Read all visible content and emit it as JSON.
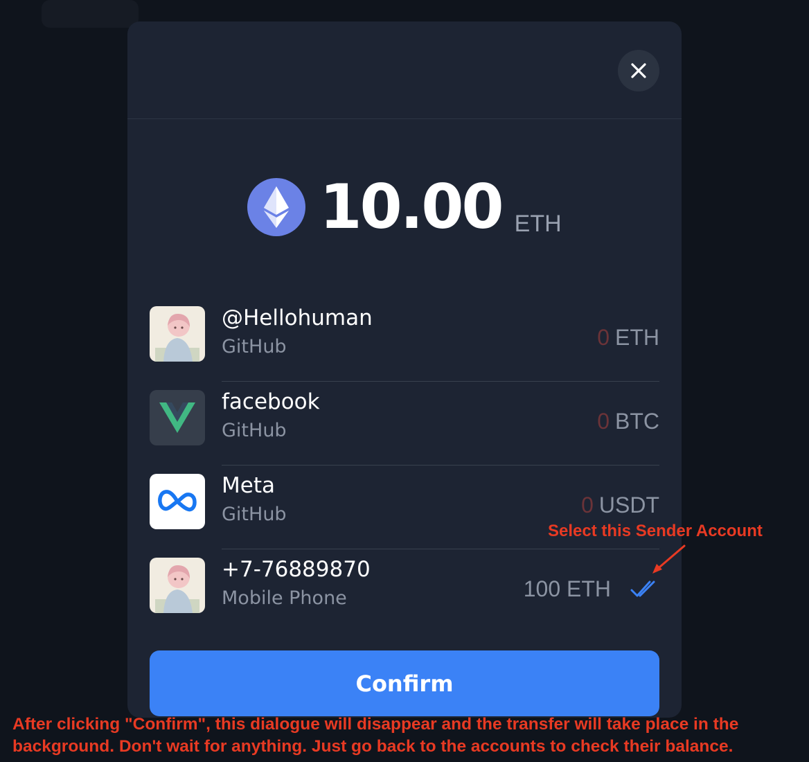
{
  "modal": {
    "close_label": "×",
    "amount": {
      "value": "10.00",
      "unit": "ETH",
      "icon": "ethereum-icon"
    },
    "accounts": [
      {
        "name": "@Hellohuman",
        "source": "GitHub",
        "balance_zero": "0",
        "balance_unit": "ETH",
        "avatar": "anime-avatar"
      },
      {
        "name": "facebook",
        "source": "GitHub",
        "balance_zero": "0",
        "balance_unit": "BTC",
        "avatar": "vue-logo"
      },
      {
        "name": "Meta",
        "source": "GitHub",
        "balance_zero": "0",
        "balance_unit": "USDT",
        "avatar": "meta-logo"
      },
      {
        "name": "+7-76889870",
        "source": "Mobile Phone",
        "balance": "100 ETH",
        "avatar": "anime-avatar",
        "selected": true
      }
    ],
    "confirm_label": "Confirm"
  },
  "annotations": {
    "select_sender": "Select this Sender Account",
    "bottom_note": "After clicking \"Confirm\", this dialogue will disappear and the transfer will take place in the background. Don't wait for anything. Just go back to the accounts to check their balance."
  },
  "colors": {
    "background": "#0f141c",
    "modal": "#1d2433",
    "accent": "#3b82f6",
    "annotation": "#e83a23",
    "zero_balance": "#6b3338"
  }
}
